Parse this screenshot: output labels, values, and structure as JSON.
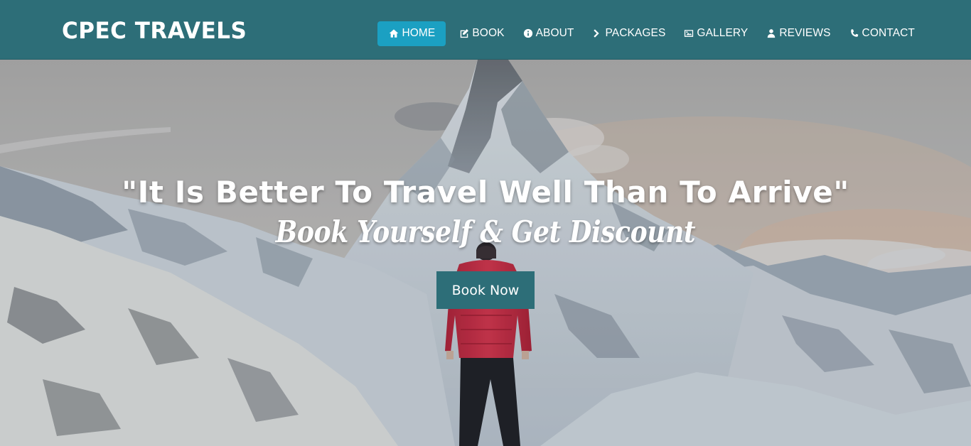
{
  "brand": {
    "name": "CPEC TRAVELS"
  },
  "nav": {
    "items": [
      {
        "label": "HOME",
        "icon": "home-icon",
        "active": true
      },
      {
        "label": "BOOK",
        "icon": "edit-icon",
        "active": false
      },
      {
        "label": "ABOUT",
        "icon": "info-circle-icon",
        "active": false
      },
      {
        "label": "PACKAGES",
        "icon": "chevron-right-icon",
        "active": false
      },
      {
        "label": "GALLERY",
        "icon": "image-icon",
        "active": false
      },
      {
        "label": "REVIEWS",
        "icon": "user-icon",
        "active": false
      },
      {
        "label": "CONTACT",
        "icon": "phone-icon",
        "active": false
      }
    ]
  },
  "hero": {
    "headline": "\"It Is Better To Travel Well Than To Arrive\"",
    "tagline": "Book Yourself & Get Discount",
    "cta_label": "Book Now"
  },
  "colors": {
    "navbar": "#2d6e78",
    "active_nav": "#1ba0c2",
    "cta": "#2d6e78"
  }
}
